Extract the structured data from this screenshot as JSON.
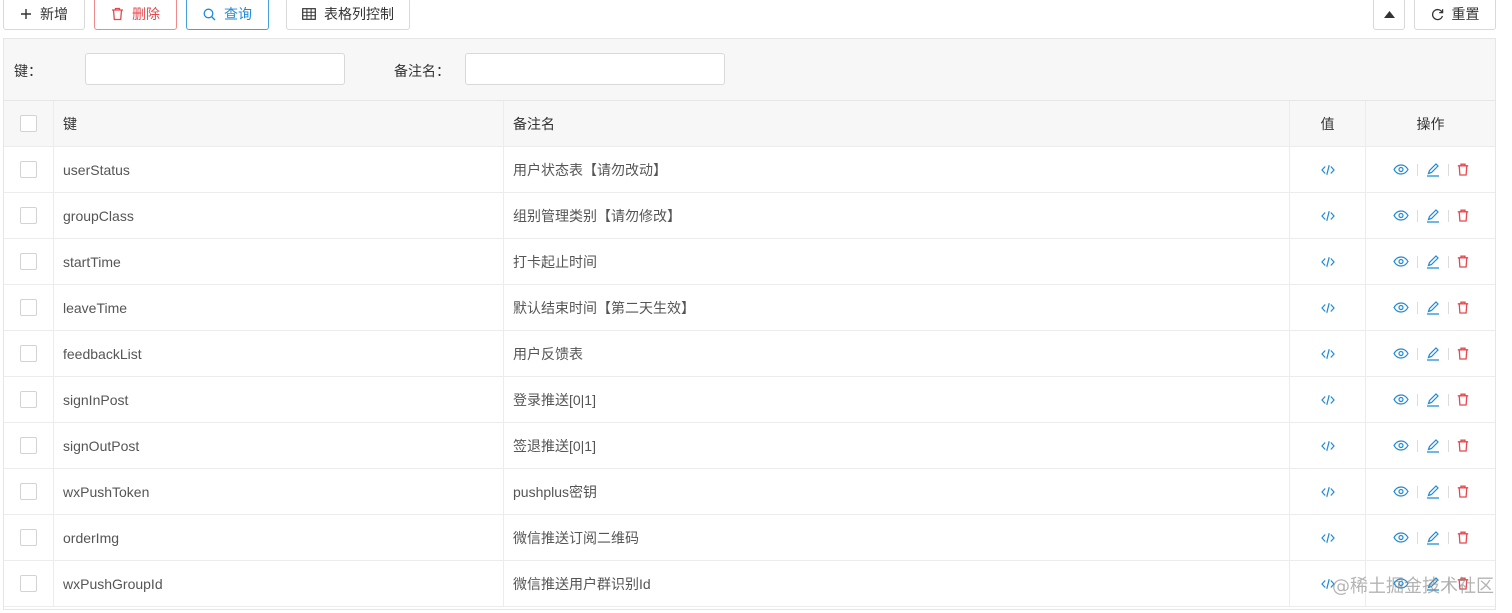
{
  "toolbar": {
    "add_label": "新增",
    "delete_label": "删除",
    "query_label": "查询",
    "columns_label": "表格列控制",
    "reset_label": "重置"
  },
  "filters": {
    "key_label": "键：",
    "key_value": "",
    "note_label": "备注名：",
    "note_value": ""
  },
  "table": {
    "headers": {
      "key": "键",
      "note": "备注名",
      "value": "值",
      "ops": "操作"
    },
    "rows": [
      {
        "key": "userStatus",
        "note": "用户状态表【请勿改动】"
      },
      {
        "key": "groupClass",
        "note": "组别管理类别【请勿修改】"
      },
      {
        "key": "startTime",
        "note": "打卡起止时间"
      },
      {
        "key": "leaveTime",
        "note": "默认结束时间【第二天生效】"
      },
      {
        "key": "feedbackList",
        "note": "用户反馈表"
      },
      {
        "key": "signInPost",
        "note": "登录推送[0|1]"
      },
      {
        "key": "signOutPost",
        "note": "签退推送[0|1]"
      },
      {
        "key": "wxPushToken",
        "note": "pushplus密钥"
      },
      {
        "key": "orderImg",
        "note": "微信推送订阅二维码"
      },
      {
        "key": "wxPushGroupId",
        "note": "微信推送用户群识别Id"
      }
    ]
  },
  "icons": {
    "value": "code-icon",
    "view": "eye-icon",
    "edit": "edit-icon",
    "delete": "trash-icon"
  },
  "colors": {
    "primary": "#1f8ad4",
    "danger": "#e5484d"
  },
  "watermark": "@稀土掘金技术社区"
}
